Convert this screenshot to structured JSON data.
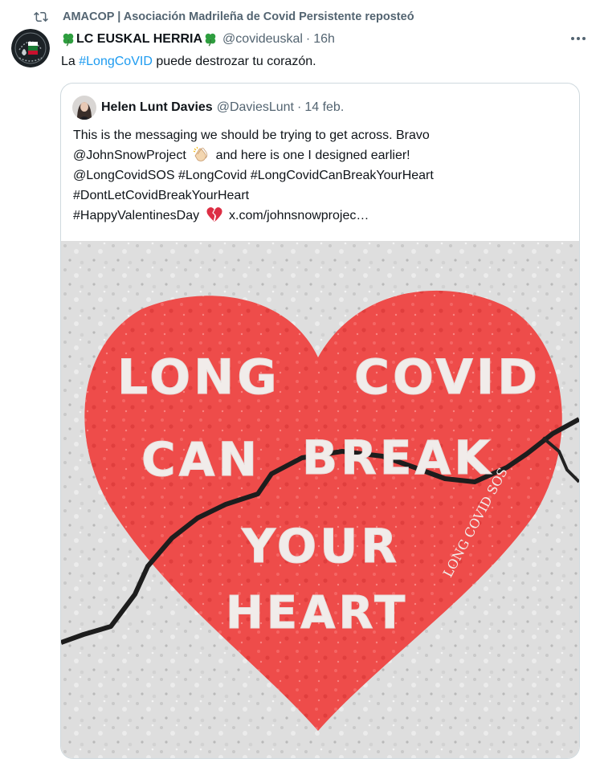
{
  "repost": {
    "icon": "repost-icon",
    "text": "AMACOP | Asociación Madrileña de Covid Persistente reposteó"
  },
  "tweet": {
    "author": {
      "name": "LC EUSKAL HERRIA",
      "name_icon": "four-leaf-clover-icon",
      "handle": "@covideuskal",
      "separator": "·",
      "time": "16h",
      "avatar_badge_text": "LONG COVID"
    },
    "text_parts": [
      "La ",
      "#LongCoVID",
      " puede destrozar tu corazón."
    ],
    "more_icon": "more-options-icon",
    "quote": {
      "author": {
        "name": "Helen Lunt Davies",
        "handle": "@DaviesLunt",
        "separator": "·",
        "date": "14 feb."
      },
      "lines": [
        "This is the messaging we should be trying to get across. Bravo",
        "@JohnSnowProject",
        "and here is one I designed earlier!",
        "@LongCovidSOS #LongCovid #LongCovidCanBreakYourHeart",
        "#DontLetCovidBreakYourHeart",
        "#HappyValentinesDay",
        "x.com/johnsnowprojec…"
      ],
      "emojis": [
        "clapping-hands-icon",
        "broken-heart-icon"
      ],
      "image": {
        "subject": "cracked-heart-mural",
        "heart_color": "#ef4a4a",
        "mural_text": [
          "LONG",
          "COVID",
          "CAN",
          "BREAK",
          "YOUR",
          "HEART"
        ],
        "watermark": "LONG COVID SOS"
      }
    }
  },
  "colors": {
    "secondary_text": "#536471",
    "link": "#1d9bf0",
    "border": "#cfd9de"
  }
}
